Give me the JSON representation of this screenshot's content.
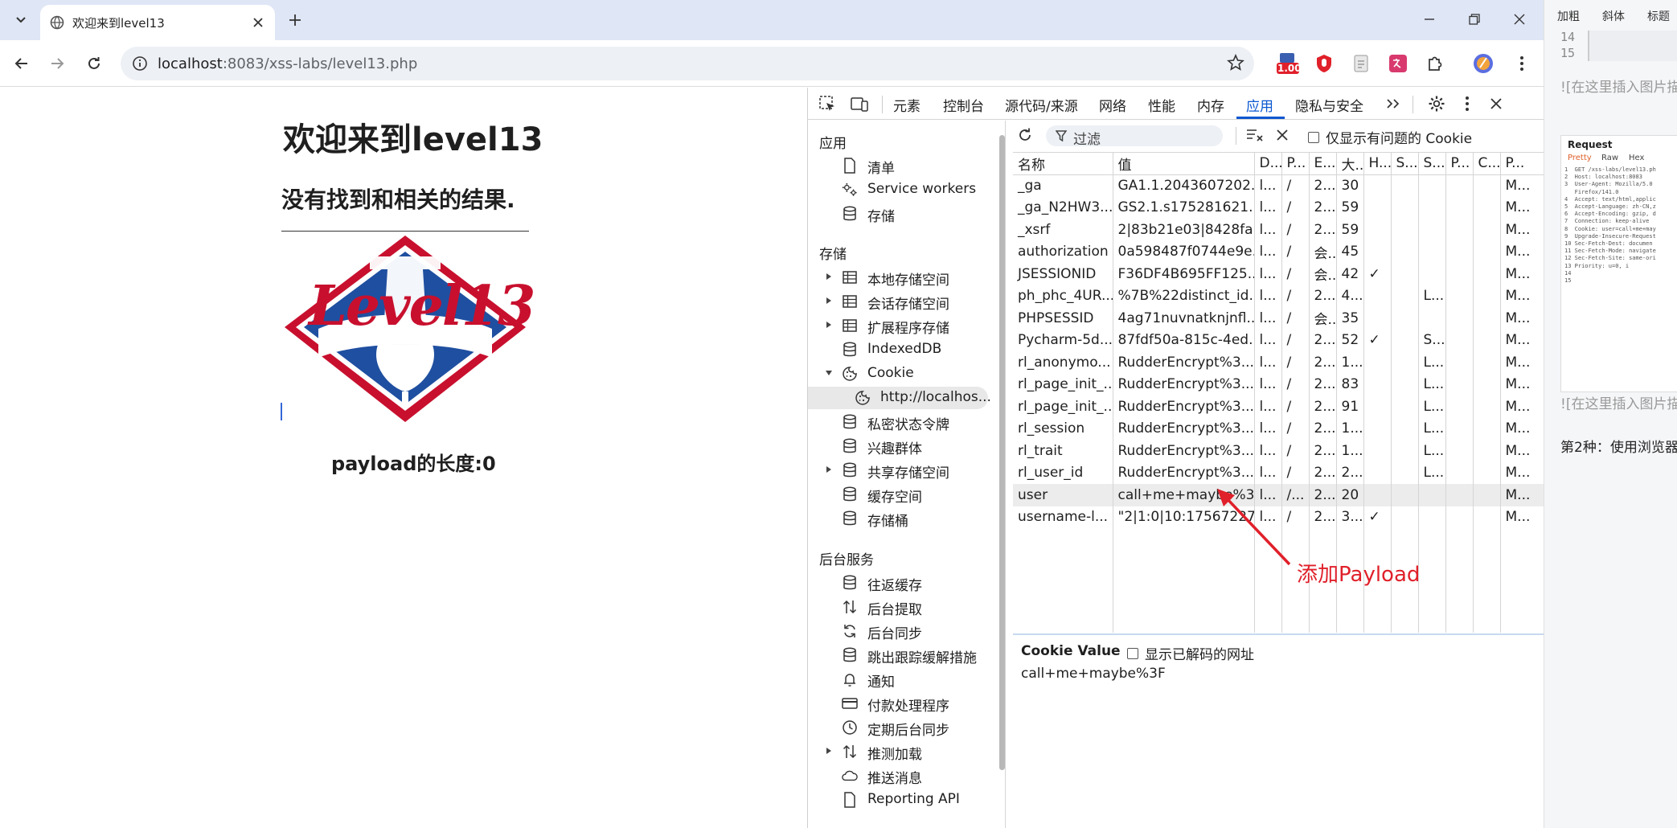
{
  "browser": {
    "tab_title": "欢迎来到level13",
    "url_host": "localhost",
    "url_rest": ":8083/xss-labs/level13.php",
    "ext_badge": "1.00"
  },
  "page": {
    "title": "欢迎来到level13",
    "result_text": "没有找到和相关的结果.",
    "logo_text": "Level13",
    "payload_label": "payload的长度:0"
  },
  "devtools": {
    "tabs": [
      "元素",
      "控制台",
      "源代码/来源",
      "网络",
      "性能",
      "内存",
      "应用",
      "隐私与安全"
    ],
    "active_tab": "应用",
    "sidebar": {
      "section_app": "应用",
      "app_items": [
        "清单",
        "Service workers",
        "存储"
      ],
      "section_storage": "存储",
      "storage_items": [
        "本地存储空间",
        "会话存储空间",
        "扩展程序存储",
        "IndexedDB",
        "Cookie"
      ],
      "cookie_origin": "http://localhos...",
      "storage_items2": [
        "私密状态令牌",
        "兴趣群体",
        "共享存储空间",
        "缓存空间",
        "存储桶"
      ],
      "section_bg": "后台服务",
      "bg_items": [
        "往返缓存",
        "后台提取",
        "后台同步",
        "跳出跟踪缓解措施",
        "通知",
        "付款处理程序",
        "定期后台同步",
        "推测加载",
        "推送消息",
        "Reporting API"
      ]
    },
    "filter_placeholder": "过滤",
    "only_issues_label": "仅显示有问题的 Cookie",
    "table": {
      "headers": [
        "名称",
        "值",
        "D...",
        "P...",
        "E...",
        "大...",
        "H...",
        "S...",
        "S...",
        "P...",
        "C...",
        "P..."
      ],
      "rows": [
        [
          "_ga",
          "GA1.1.2043607202...",
          "l...",
          "/",
          "2...",
          "30",
          "",
          "",
          "",
          "",
          "",
          "M..."
        ],
        [
          "_ga_N2HW3...",
          "GS2.1.s175281621...",
          "l...",
          "/",
          "2...",
          "59",
          "",
          "",
          "",
          "",
          "",
          "M..."
        ],
        [
          "_xsrf",
          "2|83b21e03|8428fa...",
          "l...",
          "/",
          "2...",
          "59",
          "",
          "",
          "",
          "",
          "",
          "M..."
        ],
        [
          "authorization",
          "0a598487f0744e9e...",
          "l...",
          "/",
          "会...",
          "45",
          "",
          "",
          "",
          "",
          "",
          "M..."
        ],
        [
          "JSESSIONID",
          "F36DF4B695FF125...",
          "l...",
          "/",
          "会...",
          "42",
          "✓",
          "",
          "",
          "",
          "",
          "M..."
        ],
        [
          "ph_phc_4UR...",
          "%7B%22distinct_id...",
          "l...",
          "/",
          "2...",
          "4...",
          "",
          "",
          "L...",
          "",
          "",
          "M..."
        ],
        [
          "PHPSESSID",
          "4ag71nuvnatknjnfl...",
          "l...",
          "/",
          "会...",
          "35",
          "",
          "",
          "",
          "",
          "",
          "M..."
        ],
        [
          "Pycharm-5d...",
          "87fdf50a-815c-4ed...",
          "l...",
          "/",
          "2...",
          "52",
          "✓",
          "",
          "S...",
          "",
          "",
          "M..."
        ],
        [
          "rl_anonymo...",
          "RudderEncrypt%3...",
          "l...",
          "/",
          "2...",
          "1...",
          "",
          "",
          "L...",
          "",
          "",
          "M..."
        ],
        [
          "rl_page_init_...",
          "RudderEncrypt%3...",
          "l...",
          "/",
          "2...",
          "83",
          "",
          "",
          "L...",
          "",
          "",
          "M..."
        ],
        [
          "rl_page_init_...",
          "RudderEncrypt%3...",
          "l...",
          "/",
          "2...",
          "91",
          "",
          "",
          "L...",
          "",
          "",
          "M..."
        ],
        [
          "rl_session",
          "RudderEncrypt%3...",
          "l...",
          "/",
          "2...",
          "1...",
          "",
          "",
          "L...",
          "",
          "",
          "M..."
        ],
        [
          "rl_trait",
          "RudderEncrypt%3...",
          "l...",
          "/",
          "2...",
          "1...",
          "",
          "",
          "L...",
          "",
          "",
          "M..."
        ],
        [
          "rl_user_id",
          "RudderEncrypt%3...",
          "l...",
          "/",
          "2...",
          "2...",
          "",
          "",
          "L...",
          "",
          "",
          "M..."
        ],
        [
          "user",
          "call+me+maybe%3F",
          "l...",
          "/...",
          "2...",
          "20",
          "",
          "",
          "",
          "",
          "",
          "M..."
        ],
        [
          "username-l...",
          "\"2|1:0|10:17567227...",
          "l...",
          "/",
          "2...",
          "3...",
          "✓",
          "",
          "",
          "",
          "",
          "M..."
        ]
      ],
      "selected_row": 14
    },
    "cookie_value_title": "Cookie Value",
    "show_decoded_label": "显示已解码的网址",
    "cookie_value": "call+me+maybe%3F"
  },
  "annotation": {
    "text": "添加Payload",
    "color": "#e0202a"
  },
  "editor": {
    "tools": [
      "加粗",
      "斜体",
      "标题"
    ],
    "line_numbers": [
      "14",
      "15"
    ],
    "placeholder1": "![在这里插入图片描",
    "request_title": "Request",
    "request_tabs": [
      "Pretty",
      "Raw",
      "Hex"
    ],
    "request_lines": "1  GET /xss-labs/level13.ph\n2  Host: localhost:8083\n3  User-Agent: Mozilla/5.0\n   Firefox/141.0\n4  Accept: text/html,applic\n5  Accept-Language: zh-CN,z\n6  Accept-Encoding: gzip, d\n7  Connection: keep-alive\n8  Cookie: user=call+me+may\n9  Upgrade-Insecure-Request\n10 Sec-Fetch-Dest: documen\n11 Sec-Fetch-Mode: navigate\n12 Sec-Fetch-Site: same-ori\n13 Priority: u=0, i\n14\n15",
    "placeholder2": "![在这里插入图片描",
    "method2": "第2种：使用浏览器"
  }
}
